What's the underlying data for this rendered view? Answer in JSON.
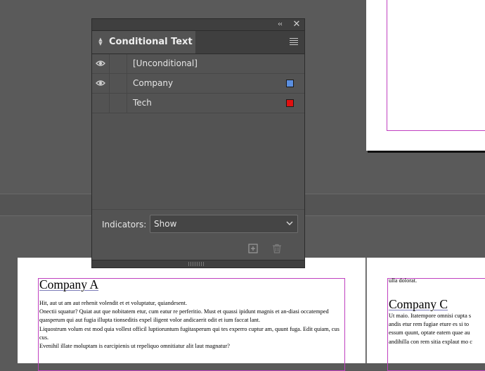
{
  "panel": {
    "title": "Conditional Text",
    "conditions": [
      {
        "label": "[Unconditional]",
        "visible": true,
        "swatch": null
      },
      {
        "label": "Company",
        "visible": true,
        "swatch": "#5b8fe0"
      },
      {
        "label": "Tech",
        "visible": false,
        "swatch": "#e01010"
      }
    ],
    "indicators_label": "Indicators:",
    "indicators_value": "Show",
    "icons": {
      "collapse": "double-chevron-left-icon",
      "close": "close-icon",
      "menu": "hamburger-menu-icon",
      "new": "new-condition-icon",
      "delete": "trash-icon",
      "visibility": "eye-icon"
    }
  },
  "document": {
    "page_left": {
      "heading": "Company A",
      "paragraphs": [
        "Hit, aut ut am aut rehenit volendit et et voluptatur, quiandesent.",
        "Onectii squatur? Quiat aut que nobitatem etur, cum eatur re perferitio. Must et quassi ipidunt magnis et an-diasi occatemped quasperum qui aut fugia illupta tionseditis expel iligent volor andicaerit odit et ium faccat lant.",
        "Liquostrum volum est mod quia vollest officil luptioruntum fugitasperum qui tes experro cuptur am, quunt fuga. Edit quiam, cus cus.",
        "Evenihil illate moluptam is earcipienis ut repeliquo omnitiatur alit laut magnatur?"
      ]
    },
    "page_right": {
      "top_line": "ulla dolorat.",
      "heading": "Company C",
      "paragraphs": [
        "Ut maio. Itatempore omnisi cupta s",
        "andis etur rem fugiae eture es si to",
        "essum quunt, optate eatem quae au",
        "andihilla con rem sitia explaut mo c"
      ]
    }
  },
  "colors": {
    "panel_bg": "#535353",
    "margin_guide": "#c040c0"
  }
}
